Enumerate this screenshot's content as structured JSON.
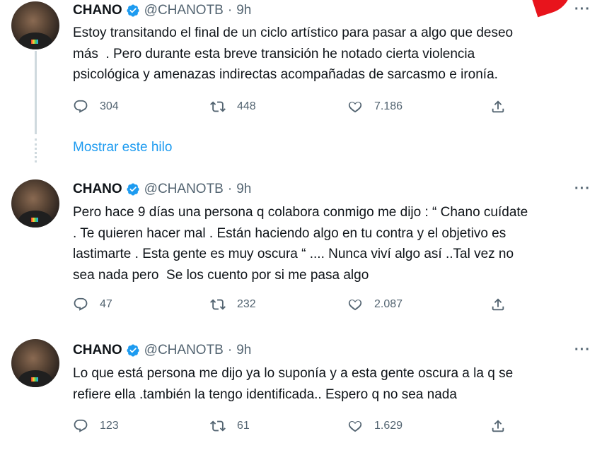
{
  "tweets": [
    {
      "name": "CHANO",
      "handle": "@CHANOTB",
      "separator": "·",
      "time": "9h",
      "text": "Estoy transitando el final de un ciclo artístico para pasar a algo que deseo\nmás  . Pero durante esta breve transición he notado cierta violencia\npsicológica y amenazas indirectas acompañadas de sarcasmo e ironía.",
      "replies": "304",
      "retweets": "448",
      "likes": "7.186"
    },
    {
      "name": "CHANO",
      "handle": "@CHANOTB",
      "separator": "·",
      "time": "9h",
      "text": "Pero hace 9 días una persona q colabora conmigo me dijo : “ Chano cuídate\n. Te quieren hacer mal . Están haciendo algo en tu contra y el objetivo es\nlastimarte . Esta gente es muy oscura “ .... Nunca viví algo así ..Tal vez no\nsea nada pero  Se los cuento por si me pasa algo",
      "replies": "47",
      "retweets": "232",
      "likes": "2.087"
    },
    {
      "name": "CHANO",
      "handle": "@CHANOTB",
      "separator": "·",
      "time": "9h",
      "text": "Lo que está persona me dijo ya lo suponía y a esta gente oscura a la q se\nrefiere ella .también la tengo identificada.. Espero q no sea nada",
      "replies": "123",
      "retweets": "61",
      "likes": "1.629"
    }
  ],
  "show_thread_label": "Mostrar este hilo",
  "more_label": "···",
  "colors": {
    "accent": "#1d9bf0",
    "muted": "#536471",
    "text": "#0f1419",
    "annotation": "#e8141c"
  },
  "icons": [
    "reply-icon",
    "retweet-icon",
    "like-icon",
    "share-icon",
    "verified-badge-icon",
    "more-icon"
  ]
}
